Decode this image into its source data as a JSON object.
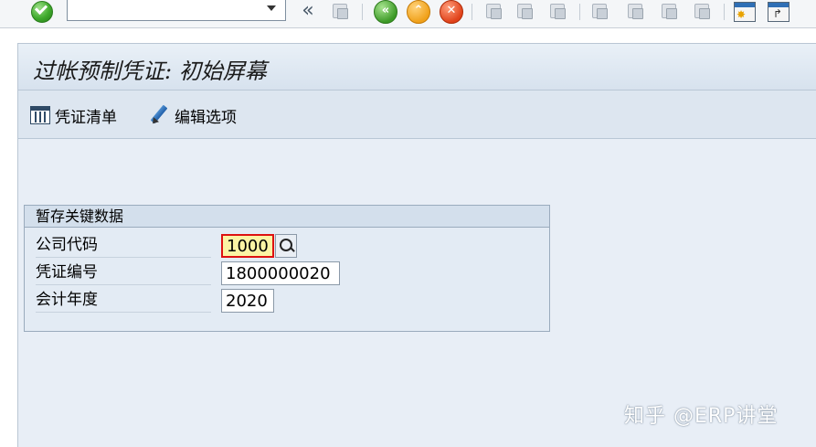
{
  "toolbar": {
    "ok_icon": "checkmark-icon",
    "command_field_value": "",
    "back_icon": "back-icon",
    "exit_icon": "exit-icon",
    "cancel_icon": "cancel-icon"
  },
  "page": {
    "title": "过帐预制凭证: 初始屏幕"
  },
  "app_toolbar": {
    "document_list_label": "凭证清单",
    "edit_options_label": "编辑选项"
  },
  "group": {
    "title": "暂存关键数据",
    "fields": {
      "company_code": {
        "label": "公司代码",
        "value": "1000"
      },
      "document_number": {
        "label": "凭证编号",
        "value": "1800000020"
      },
      "fiscal_year": {
        "label": "会计年度",
        "value": "2020"
      }
    }
  },
  "watermark": "知乎 @ERP讲堂",
  "colors": {
    "page_bg": "#e8eef6",
    "active_field_bg": "#fbf3a4",
    "active_field_border": "#dd1111"
  }
}
